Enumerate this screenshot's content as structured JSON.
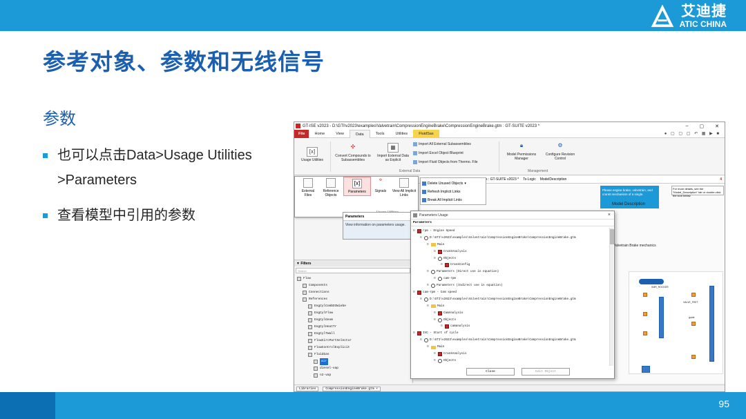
{
  "brand": {
    "logo_cn": "艾迪捷",
    "logo_en": "ATIC CHINA"
  },
  "slide": {
    "title": "参考对象、参数和无线信号",
    "subheading": "参数",
    "bullets": [
      {
        "line1": "也可以点击Data>Usage Utilities",
        "line2": ">Parameters"
      },
      {
        "line1": "查看模型中引用的参数"
      }
    ],
    "page_number": "95"
  },
  "colors": {
    "accent": "#1b9ad7",
    "title": "#1b5fb0",
    "file_tab": "#c62828",
    "fluid_tab": "#f7d44c"
  },
  "app": {
    "window_title": "GT-ISE v2023 - D:\\GTI\\v2023\\examples\\Valvetrain\\CompressionEngineBrake\\CompressionEngineBrake.gtm : GT-SUITE v2023 *",
    "window_controls": [
      "–",
      "▢",
      "✕"
    ],
    "tabs": [
      "File",
      "Home",
      "View",
      "Data",
      "Tools",
      "Utilities",
      "FluidSas"
    ],
    "active_tab": "Data",
    "ribbon": {
      "usage_utilities": "Usage Utilities",
      "convert": "Convert Compounds to Subassemblies",
      "import_external": "Import External Data as Explicit",
      "import_all": "Import All External Subassemblies",
      "import_excel": "Import Excel Object Blueprint",
      "import_fluid": "Import Fluid Objects from Thermo. File",
      "group_external": "External Data",
      "model_permissions": "Model Permissions Manager",
      "configure_revision": "Configure Revision Control",
      "group_management": "Management"
    },
    "dropdown": {
      "items": [
        "External Files",
        "Reference Objects",
        "Parameters",
        "Signals",
        "View All Implicit Links"
      ],
      "right_items": [
        "Delete Unused Objects",
        "Refresh Implicit Links",
        "Break All Implicit Links"
      ],
      "group": "Usage Utilities",
      "tooltip_title": "Parameters",
      "tooltip_body": "View information on parameters usage."
    },
    "docbar": {
      "left": "s : GT-SUITE v2023 *",
      "tab1": "Ts-Logic",
      "tab2": "ModelDescription",
      "badge": "4"
    },
    "tips": "Please engine brake, valvetrain, and crankt mechanism of a single.",
    "tips2": "For more details, see the \"Model_Description\" tab or double-click the icon below.",
    "model_label": "Model Description",
    "filters_label": "Filters",
    "search_placeholder": "Search",
    "tree": [
      {
        "label": "Flow",
        "depth": 0,
        "sel": false
      },
      {
        "label": "Components",
        "depth": 1,
        "sel": false
      },
      {
        "label": "Connections",
        "depth": 1,
        "sel": false
      },
      {
        "label": "References",
        "depth": 1,
        "sel": false
      },
      {
        "label": "EngCylCombDIWiebe",
        "depth": 2,
        "sel": false
      },
      {
        "label": "EngCylFlow",
        "depth": 2,
        "sel": false
      },
      {
        "label": "EngCylGeom",
        "depth": 2,
        "sel": false
      },
      {
        "label": "EngCylHeatTr",
        "depth": 2,
        "sel": false
      },
      {
        "label": "EngCylTWall",
        "depth": 2,
        "sel": false
      },
      {
        "label": "FlowCircPartSelector",
        "depth": 2,
        "sel": false
      },
      {
        "label": "FlowControlExplicit",
        "depth": 2,
        "sel": false
      },
      {
        "label": "FluidGas",
        "depth": 2,
        "sel": false
      },
      {
        "label": "air",
        "depth": 3,
        "sel": true
      },
      {
        "label": "diesel-vap",
        "depth": 3,
        "sel": false
      },
      {
        "label": "n2-vap",
        "depth": 3,
        "sel": false
      }
    ],
    "bottom_tabs": [
      "Libraries",
      "CompressionEngineBrake.gtm ×"
    ],
    "diagram_labels": [
      "Valvetrain Brake mechanics",
      "SMR_ROCKER",
      "VALVE_FEET",
      "guide"
    ]
  },
  "dialog": {
    "title": "Parameters Usage",
    "header": "Parameters",
    "rows": [
      {
        "icon": "param",
        "depth": 0,
        "text": "rpm - Engine Speed"
      },
      {
        "icon": "open",
        "depth": 1,
        "text": "D:\\GTI\\v2023\\examples\\Valvetrain\\CompressionEngineBrake\\CompressionEngineBrake.gtm"
      },
      {
        "icon": "folder",
        "depth": 2,
        "text": "Main"
      },
      {
        "icon": "param",
        "depth": 3,
        "text": "CrankAnalysis"
      },
      {
        "icon": "open",
        "depth": 3,
        "text": "Objects"
      },
      {
        "icon": "param",
        "depth": 4,
        "text": "CrankConfig"
      },
      {
        "icon": "open",
        "depth": 2,
        "text": "Parameters (Direct use in equation)"
      },
      {
        "icon": "open",
        "depth": 3,
        "text": "cam-rpm"
      },
      {
        "icon": "open",
        "depth": 2,
        "text": "Parameters (Indirect use in equation)"
      },
      {
        "icon": "param",
        "depth": 0,
        "text": "cam-rpm - Cam speed"
      },
      {
        "icon": "open",
        "depth": 1,
        "text": "D:\\GTI\\v2023\\examples\\Valvetrain\\CompressionEngineBrake\\CompressionEngineBrake.gtm"
      },
      {
        "icon": "folder",
        "depth": 2,
        "text": "Main"
      },
      {
        "icon": "param",
        "depth": 3,
        "text": "CamAnalysis"
      },
      {
        "icon": "open",
        "depth": 3,
        "text": "Objects"
      },
      {
        "icon": "param",
        "depth": 4,
        "text": "camanalysis"
      },
      {
        "icon": "param",
        "depth": 0,
        "text": "IVC - Start of cycle"
      },
      {
        "icon": "open",
        "depth": 1,
        "text": "D:\\GTI\\v2023\\examples\\Valvetrain\\CompressionEngineBrake\\CompressionEngineBrake.gtm"
      },
      {
        "icon": "folder",
        "depth": 2,
        "text": "Main"
      },
      {
        "icon": "param",
        "depth": 3,
        "text": "CrankAnalysis"
      },
      {
        "icon": "open",
        "depth": 3,
        "text": "Objects"
      }
    ],
    "close": "Close",
    "edit": "Edit Object"
  }
}
